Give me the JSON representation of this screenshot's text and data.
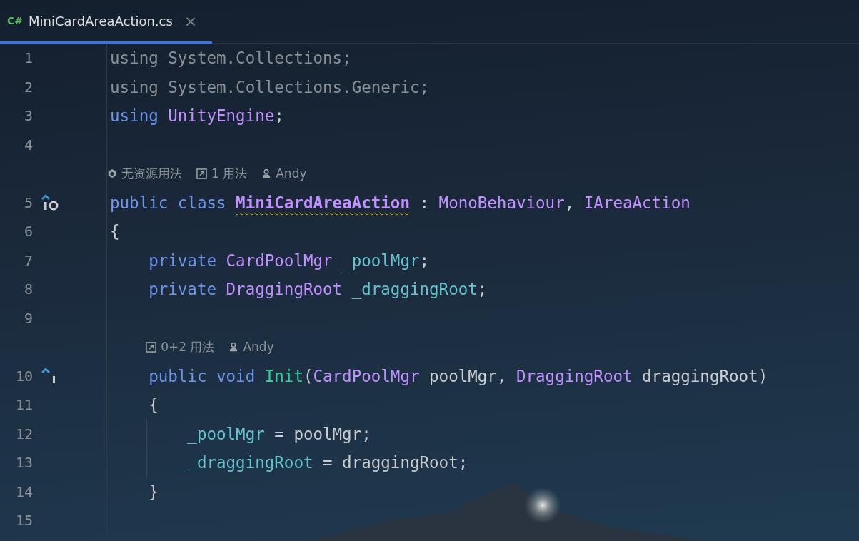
{
  "tab": {
    "icon_text": "C#",
    "label": "MiniCardAreaAction.cs",
    "selected": true,
    "close_glyph": "×"
  },
  "lines": [
    {
      "kind": "code",
      "number": "1",
      "tokens": [
        {
          "text": "using System.Collections;",
          "kind": "unused"
        }
      ]
    },
    {
      "kind": "code",
      "number": "2",
      "tokens": [
        {
          "text": "using System.Collections.Generic;",
          "kind": "unused"
        }
      ]
    },
    {
      "kind": "code",
      "number": "3",
      "tokens": [
        {
          "text": "using ",
          "kind": "keyword"
        },
        {
          "text": "UnityEngine",
          "kind": "type"
        },
        {
          "text": ";",
          "kind": "plain"
        }
      ]
    },
    {
      "kind": "code",
      "number": "4"
    },
    {
      "kind": "lens",
      "items": [
        {
          "kind": "unity",
          "text": "无资源用法"
        },
        {
          "kind": "usages",
          "text": "1 用法"
        },
        {
          "kind": "author",
          "text": "Andy"
        }
      ]
    },
    {
      "kind": "code",
      "number": "5",
      "implemented_marker": true,
      "tokens": [
        {
          "text": "public class ",
          "kind": "keyword"
        },
        {
          "text": "MiniCardAreaAction",
          "kind": "type",
          "bold": true,
          "warning": true
        },
        {
          "text": " : ",
          "kind": "plain"
        },
        {
          "text": "MonoBehaviour",
          "kind": "type"
        },
        {
          "text": ", ",
          "kind": "plain"
        },
        {
          "text": "IAreaAction",
          "kind": "type"
        }
      ]
    },
    {
      "kind": "code",
      "number": "6",
      "tokens": [
        {
          "text": "{",
          "kind": "plain"
        }
      ]
    },
    {
      "kind": "code",
      "number": "7",
      "tokens": [
        {
          "text": "    private ",
          "kind": "keyword"
        },
        {
          "text": "CardPoolMgr ",
          "kind": "type"
        },
        {
          "text": "_poolMgr",
          "kind": "field"
        },
        {
          "text": ";",
          "kind": "plain"
        }
      ]
    },
    {
      "kind": "code",
      "number": "8",
      "tokens": [
        {
          "text": "    private ",
          "kind": "keyword"
        },
        {
          "text": "DraggingRoot ",
          "kind": "type"
        },
        {
          "text": "_draggingRoot",
          "kind": "field"
        },
        {
          "text": ";",
          "kind": "plain"
        }
      ]
    },
    {
      "kind": "code",
      "number": "9"
    },
    {
      "kind": "lens",
      "items": [
        {
          "kind": "usages",
          "text": "0+2 用法"
        },
        {
          "kind": "author",
          "text": "Andy"
        }
      ]
    },
    {
      "kind": "code",
      "number": "10",
      "implements_marker": true,
      "tokens": [
        {
          "text": "    public void ",
          "kind": "keyword"
        },
        {
          "text": "Init",
          "kind": "method"
        },
        {
          "text": "(",
          "kind": "plain"
        },
        {
          "text": "CardPoolMgr",
          "kind": "type"
        },
        {
          "text": " poolMgr, ",
          "kind": "plain"
        },
        {
          "text": "DraggingRoot",
          "kind": "type"
        },
        {
          "text": " draggingRoot)",
          "kind": "plain"
        }
      ]
    },
    {
      "kind": "code",
      "number": "11",
      "tokens": [
        {
          "text": "    {",
          "kind": "plain"
        }
      ]
    },
    {
      "kind": "code",
      "number": "12",
      "tokens": [
        {
          "text": "        _poolMgr",
          "kind": "field"
        },
        {
          "text": " = poolMgr;",
          "kind": "plain"
        }
      ]
    },
    {
      "kind": "code",
      "number": "13",
      "tokens": [
        {
          "text": "        _draggingRoot",
          "kind": "field"
        },
        {
          "text": " = draggingRoot;",
          "kind": "plain"
        }
      ]
    },
    {
      "kind": "code",
      "number": "14",
      "tokens": [
        {
          "text": "    }",
          "kind": "plain"
        }
      ]
    },
    {
      "kind": "code",
      "number": "15"
    }
  ]
}
